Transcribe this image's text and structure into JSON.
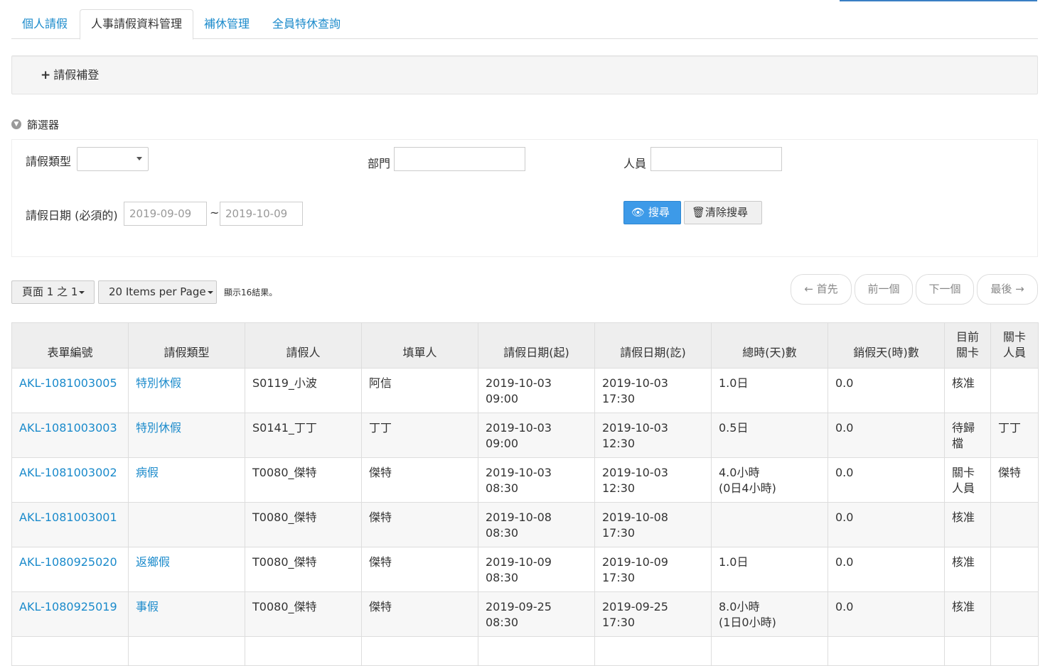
{
  "tabs": [
    {
      "label": "個人請假",
      "active": false
    },
    {
      "label": "人事請假資料管理",
      "active": true
    },
    {
      "label": "補休管理",
      "active": false
    },
    {
      "label": "全員特休查詢",
      "active": false
    }
  ],
  "actions": {
    "add_leave_label": "請假補登"
  },
  "filter": {
    "title": "篩選器",
    "leave_type_label": "請假類型",
    "leave_type_value": "",
    "department_label": "部門",
    "department_value": "",
    "person_label": "人員",
    "person_value": "",
    "date_label": "請假日期 (必須的)",
    "date_from": "2019-09-09",
    "date_sep": "~",
    "date_to": "2019-10-09",
    "search_label": "搜尋",
    "clear_label": "清除搜尋"
  },
  "pager": {
    "page_label": "頁面 1 之 1",
    "per_page_label": "20 Items per Page",
    "result_text": "顯示16結果。",
    "first_label": "← 首先",
    "prev_label": "前一個",
    "next_label": "下一個",
    "last_label": "最後 →"
  },
  "table": {
    "headers": [
      "表單編號",
      "請假類型",
      "請假人",
      "填單人",
      "請假日期(起)",
      "請假日期(訖)",
      "總時(天)數",
      "銷假天(時)數",
      "目前\n關卡",
      "關卡\n人員"
    ],
    "rows": [
      {
        "form_no": "AKL-1081003005",
        "type": "特別休假",
        "applicant": "S0119_小波",
        "filler": "阿信",
        "start": "2019-10-03 09:00",
        "end": "2019-10-03 17:30",
        "total": "1.0日",
        "cancel": "0.0",
        "stage": "核准",
        "stage_person": ""
      },
      {
        "form_no": "AKL-1081003003",
        "type": "特別休假",
        "applicant": "S0141_丁丁",
        "filler": "丁丁",
        "start": "2019-10-03 09:00",
        "end": "2019-10-03 12:30",
        "total": "0.5日",
        "cancel": "0.0",
        "stage": "待歸\n檔",
        "stage_person": "丁丁"
      },
      {
        "form_no": "AKL-1081003002",
        "type": "病假",
        "applicant": "T0080_傑特",
        "filler": "傑特",
        "start": "2019-10-03 08:30",
        "end": "2019-10-03 12:30",
        "total": "4.0小時\n(0日4小時)",
        "cancel": "0.0",
        "stage": "關卡\n人員",
        "stage_person": "傑特"
      },
      {
        "form_no": "AKL-1081003001",
        "type": "",
        "applicant": "T0080_傑特",
        "filler": "傑特",
        "start": "2019-10-08 08:30",
        "end": "2019-10-08 17:30",
        "total": "",
        "cancel": "0.0",
        "stage": "核准",
        "stage_person": ""
      },
      {
        "form_no": "AKL-1080925020",
        "type": "返鄉假",
        "applicant": "T0080_傑特",
        "filler": "傑特",
        "start": "2019-10-09 08:30",
        "end": "2019-10-09 17:30",
        "total": "1.0日",
        "cancel": "0.0",
        "stage": "核准",
        "stage_person": ""
      },
      {
        "form_no": "AKL-1080925019",
        "type": "事假",
        "applicant": "T0080_傑特",
        "filler": "傑特",
        "start": "2019-09-25 08:30",
        "end": "2019-09-25 17:30",
        "total": "8.0小時\n(1日0小時)",
        "cancel": "0.0",
        "stage": "核准",
        "stage_person": ""
      },
      {
        "form_no": "",
        "type": "",
        "applicant": "",
        "filler": "",
        "start": "",
        "end": "",
        "total": "",
        "cancel": "",
        "stage": "",
        "stage_person": ""
      }
    ]
  },
  "colors": {
    "accent": "#3a7fc4",
    "link": "#1a8acb",
    "primary_button": "#3d9ae8"
  }
}
